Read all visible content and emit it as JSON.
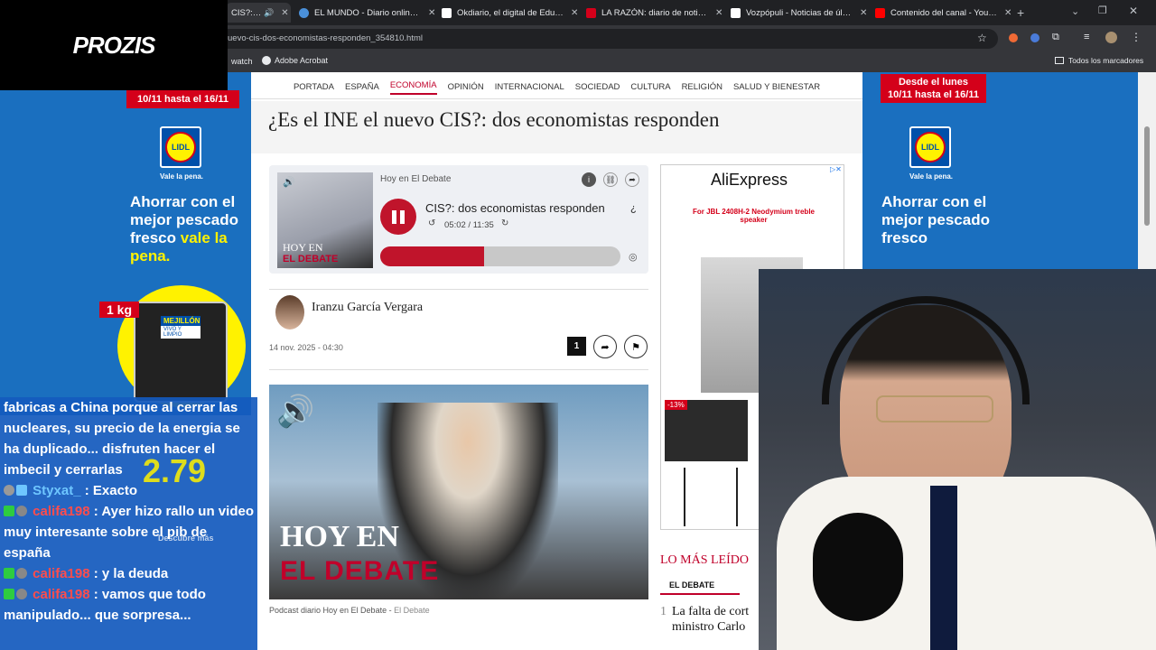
{
  "tabs": [
    {
      "label": "CIS?: do",
      "color": "#c0002a",
      "active": true
    },
    {
      "label": "EL MUNDO - Diario online líder",
      "color": "#4a90d9"
    },
    {
      "label": "Okdiario, el digital de Eduardo",
      "color": "#ffffff"
    },
    {
      "label": "LA RAZÓN: diario de noticias, a",
      "color": "#d4001a"
    },
    {
      "label": "Vozpópuli - Noticias de última",
      "color": "#ffffff"
    },
    {
      "label": "Contenido del canal - YouTube",
      "color": "#ff0000"
    }
  ],
  "omnibox": {
    "url": "uevo-cis-dos-economistas-responden_354810.html"
  },
  "bookmarks": {
    "item1": "watch",
    "item2": "Adobe Acrobat",
    "all": "Todos los marcadores"
  },
  "overlay": {
    "brand": "PROZIS"
  },
  "lidl_left": {
    "dates": "10/11 hasta el 16/11",
    "logo": "LIDL",
    "tagline": "Vale la pena.",
    "headline": "Ahorrar con el mejor pescado fresco",
    "headline_yellow": "vale la pena.",
    "weight": "1 kg",
    "product": "MEJILLÓN",
    "product_sub": "VIVO Y LIMPIO",
    "price": "2.79",
    "cta": "Descubre más"
  },
  "lidl_right": {
    "dates_line1": "Desde el lunes",
    "dates_line2": "10/11 hasta el 16/11",
    "logo": "LIDL",
    "tagline": "Vale la pena.",
    "headline": "Ahorrar con el mejor pescado fresco"
  },
  "nav": [
    "PORTADA",
    "ESPAÑA",
    "ECONOMÍA",
    "OPINIÓN",
    "INTERNACIONAL",
    "SOCIEDAD",
    "CULTURA",
    "RELIGIÓN",
    "SALUD Y BIENESTAR"
  ],
  "nav_active": "ECONOMÍA",
  "article": {
    "headline": "¿Es el INE el nuevo CIS?: dos economistas responden",
    "author": "Iranzu García Vergara",
    "date": "14 nov. 2025 - 04:30",
    "comments": "1",
    "caption": "Podcast diario Hoy en El Debate",
    "caption_source": "El Debate"
  },
  "player": {
    "show": "Hoy en El Debate",
    "title": "CIS?: dos economistas responden",
    "title_suffix": "¿",
    "time": "05:02 / 11:35",
    "progress": 0.434,
    "thumb_line1": "HOY EN",
    "thumb_line2": "EL DEBATE"
  },
  "hero": {
    "line1": "HOY EN",
    "line2": "EL DEBATE"
  },
  "ad": {
    "brand": "AliExpress",
    "product": "For JBL 2408H-2 Neodymium treble speaker",
    "discount": "-13%"
  },
  "most_read": {
    "title": "LO MÁS LEÍDO",
    "tab": "EL DEBATE",
    "item_number": "1",
    "item_text": "La falta de cort ministro Carlo"
  },
  "chat": [
    {
      "user": "",
      "text": "fabricas a China porque al cerrar las nucleares, su precio de la energia se ha duplicado... disfruten hacer el imbecil y cerrarlas"
    },
    {
      "user": "Styxat_",
      "text": ": Exacto",
      "blue": true
    },
    {
      "user": "califa198",
      "text": ": Ayer hizo rallo un video muy interesante sobre el pib de españa"
    },
    {
      "user": "califa198",
      "text": ": y la deuda"
    },
    {
      "user": "califa198",
      "text": ": vamos que todo manipulado... que sorpresa..."
    }
  ]
}
